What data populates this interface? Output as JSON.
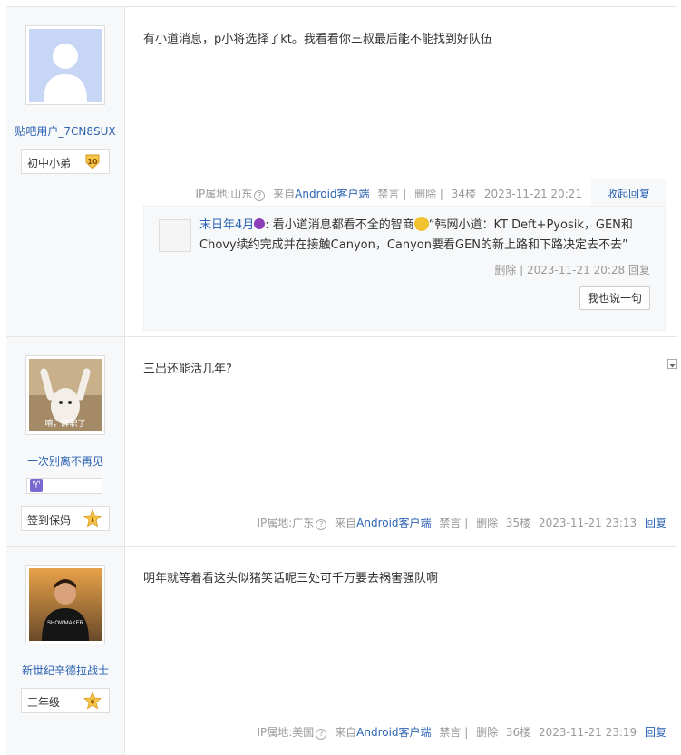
{
  "posts": [
    {
      "username": "贴吧用户_7CN8SUX",
      "title_badge": "初中小弟",
      "level": "10",
      "content": "有小道消息，p小将选择了kt。我看看你三叔最后能不能找到好队伍",
      "ip": "IP属地:山东",
      "source_prefix": "来自",
      "source": "Android客户端",
      "ban": "禁言",
      "delete": "删除",
      "floor": "34楼",
      "time": "2023-11-21 20:21",
      "action": "收起回复",
      "reply": {
        "user": "末日年4月",
        "text_1": ": 看小道消息都看不全的智商",
        "text_2": "“韩网小道：KT Deft+Pyosik，GEN和Chovy续约完成并在接触Canyon，Canyon要看GEN的新上路和下路决定去不去”",
        "delete": "删除",
        "time": "2023-11-21 20:28",
        "reply_label": "回复",
        "say_button": "我也说一句"
      }
    },
    {
      "username": "一次别离不再见",
      "zodiac_icon": "♈",
      "title_badge": "签到保妈",
      "level": "1",
      "avatar_caption": "唷，辞职了",
      "content": "三出还能活几年?",
      "ip": "IP属地:广东",
      "source_prefix": "来自",
      "source": "Android客户端",
      "ban": "禁言",
      "delete": "删除",
      "floor": "35楼",
      "time": "2023-11-21 23:13",
      "action": "回复"
    },
    {
      "username": "新世纪辛德拉战士",
      "title_badge": "三年级",
      "level": "6",
      "avatar_caption": "SHOWMAKER",
      "content": "明年就等着看这头似猪笑话呢三处可千万要去祸害强队啊",
      "ip": "IP属地:美国",
      "source_prefix": "来自",
      "source": "Android客户端",
      "ban": "禁言",
      "delete": "删除",
      "floor": "36楼",
      "time": "2023-11-21 23:19",
      "action": "回复"
    }
  ],
  "colors": {
    "link": "#2d64b3",
    "sidebar_bg": "#f7f8fa",
    "meta": "#999999"
  }
}
